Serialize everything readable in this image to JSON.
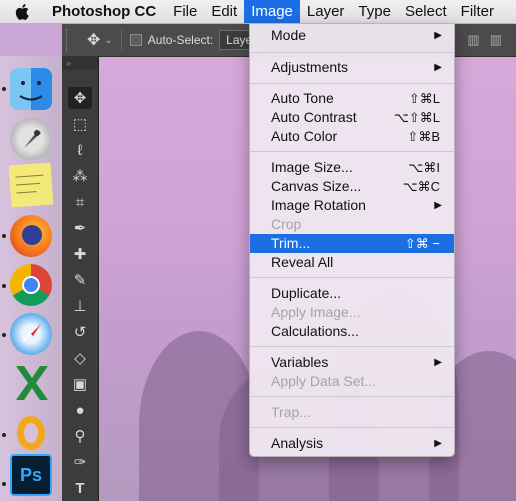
{
  "menubar": {
    "app": "Photoshop CC",
    "items": [
      "File",
      "Edit",
      "Image",
      "Layer",
      "Type",
      "Select",
      "Filter"
    ],
    "active": "Image"
  },
  "options_bar": {
    "auto_select_label": "Auto-Select:",
    "auto_select_value": "Layer"
  },
  "image_menu": {
    "mode": "Mode",
    "adjustments": "Adjustments",
    "auto_tone": "Auto Tone",
    "auto_tone_sc": "⇧⌘L",
    "auto_contrast": "Auto Contrast",
    "auto_contrast_sc": "⌥⇧⌘L",
    "auto_color": "Auto Color",
    "auto_color_sc": "⇧⌘B",
    "image_size": "Image Size...",
    "image_size_sc": "⌥⌘I",
    "canvas_size": "Canvas Size...",
    "canvas_size_sc": "⌥⌘C",
    "image_rotation": "Image Rotation",
    "crop": "Crop",
    "trim": "Trim...",
    "trim_sc": "⇧⌘ −",
    "reveal_all": "Reveal All",
    "duplicate": "Duplicate...",
    "apply_image": "Apply Image...",
    "calculations": "Calculations...",
    "variables": "Variables",
    "apply_data_set": "Apply Data Set...",
    "trap": "Trap...",
    "analysis": "Analysis"
  },
  "dock_icons": [
    "finder",
    "launchpad",
    "stickies",
    "firefox",
    "chrome",
    "safari",
    "excel",
    "outlook",
    "photoshop"
  ],
  "photoshop_dock_label": "Ps",
  "colors": {
    "highlight": "#1b6fe3",
    "ps_blue": "#31a8ff"
  }
}
